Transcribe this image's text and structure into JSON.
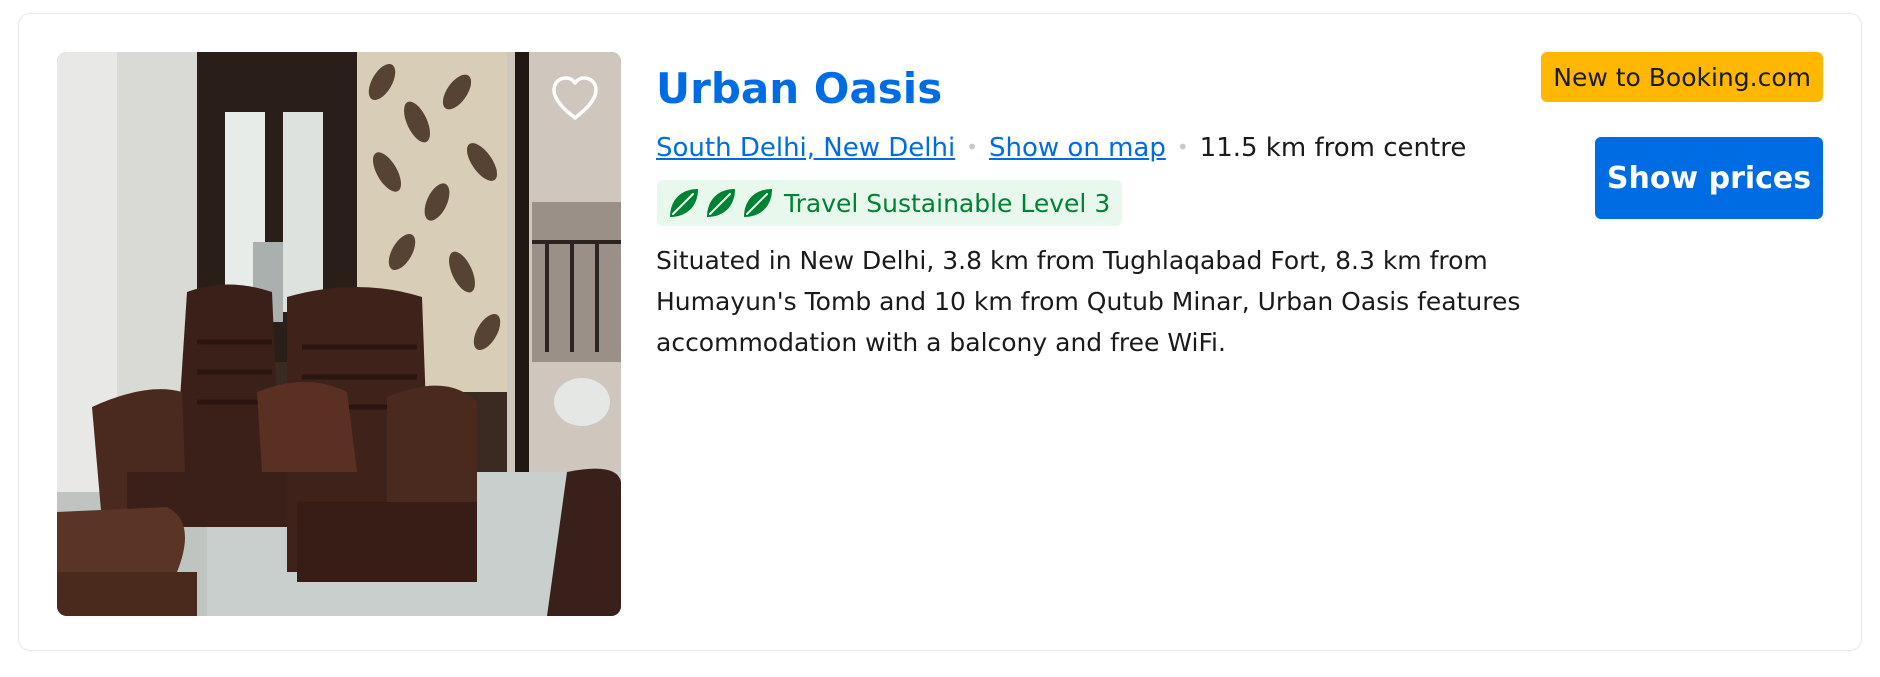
{
  "property": {
    "name": "Urban Oasis",
    "location_link": "South Delhi, New Delhi",
    "map_link": "Show on map",
    "distance": "11.5 km from centre",
    "sustainability_label": "Travel Sustainable Level 3",
    "sustainability_level": 3,
    "description": "Situated in New Delhi, 3.8 km from Tughlaqabad Fort, 8.3 km from Humayun's Tomb and 10 km from Qutub Minar, Urban Oasis features accommodation with a balcony and free WiFi.",
    "badge": "New to Booking.com",
    "cta_label": "Show prices"
  },
  "icons": {
    "favorite": "heart-outline-icon",
    "sustainability": "leaf-icon"
  },
  "colors": {
    "brand_blue": "#006ce4",
    "badge_yellow": "#ffb700",
    "sustainability_green": "#008234",
    "sustainability_bg": "#e9f8ec",
    "card_border": "#e7e7e7"
  }
}
